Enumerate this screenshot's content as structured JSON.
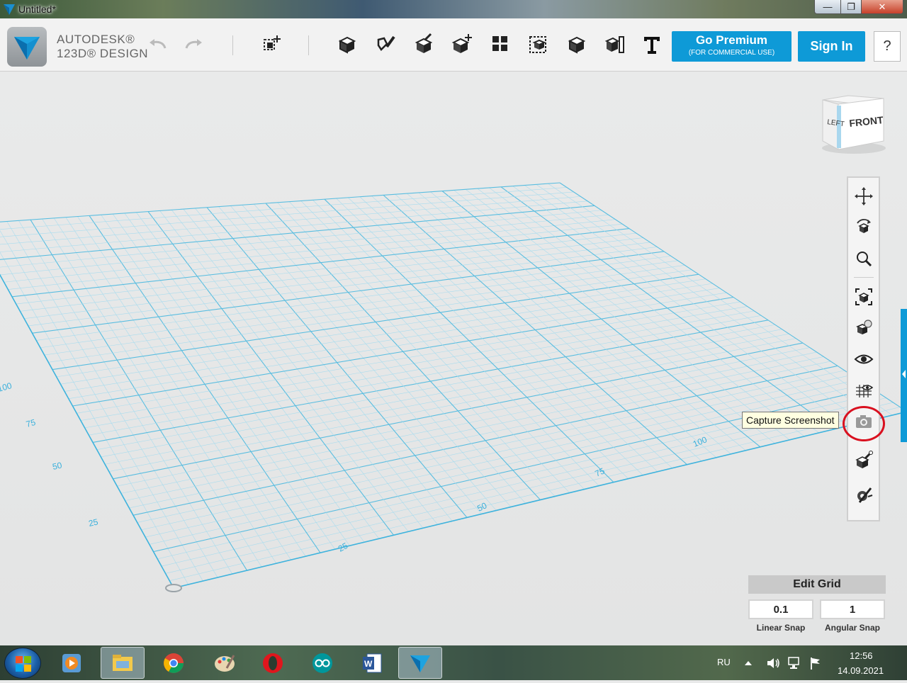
{
  "window": {
    "title": "Untitled*",
    "minimize": "—",
    "maximize": "❐",
    "close": "✕"
  },
  "toolbar": {
    "brand_line1": "AUTODESK®",
    "brand_line2": "123D® DESIGN",
    "tools": [
      "undo-icon",
      "redo-icon",
      "transform-icon",
      "primitives-icon",
      "sketch-icon",
      "construct-icon",
      "modify-icon",
      "pattern-icon",
      "grouping-icon",
      "combine-icon",
      "measure-icon",
      "text-icon",
      "snap-icon"
    ],
    "premium_label": "Go Premium",
    "premium_sub": "(FOR COMMERCIAL USE)",
    "signin_label": "Sign In",
    "help_label": "?"
  },
  "viewcube": {
    "left_face": "LEFT",
    "front_face": "FRONT"
  },
  "navbar": {
    "items": [
      "pan-icon",
      "orbit-icon",
      "zoom-icon",
      "fit-icon",
      "views-icon",
      "visibility-icon",
      "grid-material-icon",
      "camera-icon",
      "material-icon",
      "settings-icon"
    ],
    "tooltip": "Capture Screenshot"
  },
  "grid_labels": {
    "left_axis": [
      "100",
      "75",
      "50",
      "25"
    ],
    "front_axis": [
      "25",
      "50",
      "75",
      "100"
    ]
  },
  "edit_grid": {
    "title": "Edit Grid",
    "linear_value": "0.1",
    "angular_value": "1",
    "linear_label": "Linear Snap",
    "angular_label": "Angular Snap"
  },
  "taskbar": {
    "apps": [
      "media-player-icon",
      "file-explorer-icon",
      "chrome-icon",
      "paint-icon",
      "opera-icon",
      "arduino-icon",
      "word-icon",
      "123d-design-icon"
    ],
    "language": "RU",
    "time": "12:56",
    "date": "14.09.2021"
  },
  "colors": {
    "accent": "#0e9ad7",
    "grid": "#5bc0de",
    "highlight": "#d9101f"
  }
}
